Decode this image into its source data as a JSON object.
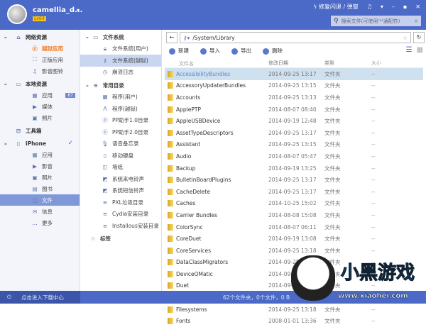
{
  "header": {
    "username": "camellia_d...",
    "level": "Lv64",
    "repair": "修复闪退 / 弹窗",
    "search_placeholder": "搜索文件(可使用'*'通配符)"
  },
  "sidebar": {
    "groups": [
      {
        "label": "网络资源",
        "items": [
          {
            "label": "越狱应用",
            "icon": "p-icon",
            "orange": true
          },
          {
            "label": "正版应用",
            "icon": "app-store-icon"
          },
          {
            "label": "影音图铃",
            "icon": "music-icon"
          }
        ],
        "icon": "home-icon"
      },
      {
        "label": "本地资源",
        "icon": "monitor-icon",
        "items": [
          {
            "label": "应用",
            "icon": "grid-icon",
            "badge": "67"
          },
          {
            "label": "媒体",
            "icon": "video-icon"
          },
          {
            "label": "照片",
            "icon": "photo-icon"
          }
        ]
      },
      {
        "label": "工具箱",
        "icon": "toolbox-icon",
        "items": []
      },
      {
        "label": "iPhone",
        "icon": "phone-icon",
        "items": [
          {
            "label": "应用",
            "icon": "grid-icon"
          },
          {
            "label": "影音",
            "icon": "video-icon"
          },
          {
            "label": "照片",
            "icon": "photo-icon"
          },
          {
            "label": "图书",
            "icon": "book-icon"
          },
          {
            "label": "文件",
            "icon": "file-icon",
            "selected": true
          },
          {
            "label": "信息",
            "icon": "message-icon"
          },
          {
            "label": "更多",
            "icon": "more-icon"
          }
        ]
      }
    ]
  },
  "tree": {
    "groups": [
      {
        "label": "文件系统",
        "icon": "monitor-icon",
        "items": [
          {
            "label": "文件系统(用户)",
            "icon": "lock-icon"
          },
          {
            "label": "文件系统(越狱)",
            "icon": "key-icon",
            "selected": true
          },
          {
            "label": "崩溃日志",
            "icon": "clock-icon"
          }
        ]
      },
      {
        "label": "常用目录",
        "icon": "list-icon",
        "items": [
          {
            "label": "程序(用户)",
            "icon": "grid-icon"
          },
          {
            "label": "程序(越狱)",
            "icon": "a-icon"
          },
          {
            "label": "PP助手1.0目录",
            "icon": "p-icon"
          },
          {
            "label": "PP助手2.0目录",
            "icon": "p-icon"
          },
          {
            "label": "语音备忘录",
            "icon": "mic-icon"
          },
          {
            "label": "移动硬盘",
            "icon": "disk-icon"
          },
          {
            "label": "墙纸",
            "icon": "wallpaper-icon"
          },
          {
            "label": "系统来电铃声",
            "icon": "ringtone-icon"
          },
          {
            "label": "系统短信铃声",
            "icon": "ringtone-icon"
          },
          {
            "label": "PXL垃圾目录",
            "icon": "list-icon"
          },
          {
            "label": "Cydia安装目录",
            "icon": "list-icon"
          },
          {
            "label": "Installous安装目录",
            "icon": "list-icon"
          }
        ]
      },
      {
        "label": "标签",
        "icon": "star-icon",
        "items": []
      }
    ]
  },
  "main": {
    "path": "/System/Library",
    "toolbar": [
      "新建",
      "导入",
      "导出",
      "删除"
    ],
    "columns": [
      "文件名",
      "修改日期",
      "类型",
      "大小"
    ],
    "files": [
      [
        "AccessibilityBundles",
        "2014-09-25 13:17"
      ],
      [
        "AccessoryUpdaterBundles",
        "2014-09-25 13:15"
      ],
      [
        "Accounts",
        "2014-09-25 13:13"
      ],
      [
        "ApplePTP",
        "2014-08-07 08:40"
      ],
      [
        "AppleUSBDevice",
        "2014-09-19 12:48"
      ],
      [
        "AssetTypeDescriptors",
        "2014-09-25 13:17"
      ],
      [
        "Assistant",
        "2014-09-25 13:15"
      ],
      [
        "Audio",
        "2014-08-07 05:47"
      ],
      [
        "Backup",
        "2014-09-19 13:25"
      ],
      [
        "BulletinBoardPlugins",
        "2014-09-25 13:17"
      ],
      [
        "CacheDelete",
        "2014-09-25 13:17"
      ],
      [
        "Caches",
        "2014-10-25 15:02"
      ],
      [
        "Carrier Bundles",
        "2014-08-08 15:08"
      ],
      [
        "ColorSync",
        "2014-08-07 06:11"
      ],
      [
        "CoreDuet",
        "2014-09-19 13:08"
      ],
      [
        "CoreServices",
        "2014-09-25 13:18"
      ],
      [
        "DataClassMigrators",
        "2014-09-25 13:18"
      ],
      [
        "DeviceOMatic",
        "2014-09-25 13:14"
      ],
      [
        "Duet",
        "2014-09-19 13:49"
      ],
      [
        "Extensions",
        "2008-01-01 13:36"
      ],
      [
        "Filesystems",
        "2014-09-25 13:18"
      ],
      [
        "Fonts",
        "2008-01-01 13:36"
      ]
    ],
    "file_type": "文件夹",
    "file_size": "--"
  },
  "footer": {
    "download": "点击进入下载中心",
    "status": "62个文件夹，0个文件，0 B"
  },
  "watermark": {
    "logo": "小黑游戏",
    "url": "www.xiaohei.com"
  },
  "colors": {
    "accent": "#4b69c6",
    "selected": "#7f98d8"
  }
}
